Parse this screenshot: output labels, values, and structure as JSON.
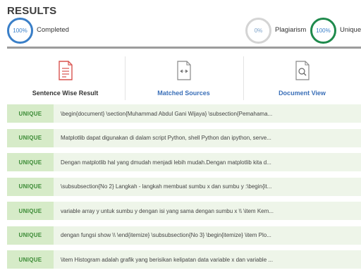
{
  "header": {
    "title": "RESULTS",
    "completed": {
      "value": "100%",
      "label": "Completed"
    },
    "plagiarism": {
      "value": "0%",
      "label": "Plagiarism"
    },
    "unique": {
      "value": "100%",
      "label": "Unique"
    }
  },
  "tabs": [
    {
      "label": "Sentence Wise Result",
      "icon": "document-list-icon"
    },
    {
      "label": "Matched Sources",
      "icon": "document-arrows-icon"
    },
    {
      "label": "Document View",
      "icon": "document-search-icon"
    }
  ],
  "colors": {
    "accent": "#3a7fc8",
    "unique_ring": "#1f8a4c",
    "badge_bg": "#d6ebc8",
    "row_bg": "#eef5e9",
    "badge_text": "#3a8a34"
  },
  "rows": [
    {
      "status": "UNIQUE",
      "text": "\\begin{document} \\section{Muhammad Abdul Gani Wijaya} \\subsection{Pemahama..."
    },
    {
      "status": "UNIQUE",
      "text": "Matplotlib dapat digunakan di dalam script Python, shell Python dan ipython, serve..."
    },
    {
      "status": "UNIQUE",
      "text": "Dengan matplotlib hal yang dmudah menjadi lebih mudah.Dengan matplotlib kita d..."
    },
    {
      "status": "UNIQUE",
      "text": "\\subsubsection{No 2} Langkah - langkah membuat sumbu x dan sumbu y :\\begin{it..."
    },
    {
      "status": "UNIQUE",
      "text": "variable array y untuk sumbu y dengan isi yang sama dengan sumbu x \\\\ \\item Kem..."
    },
    {
      "status": "UNIQUE",
      "text": "dengan fungsi show \\\\ \\end{itemize} \\subsubsection{No 3} \\begin{itemize} \\item Plo..."
    },
    {
      "status": "UNIQUE",
      "text": "\\item Histogram adalah grafik yang berisikan kelipatan data variable x dan variable ..."
    }
  ]
}
